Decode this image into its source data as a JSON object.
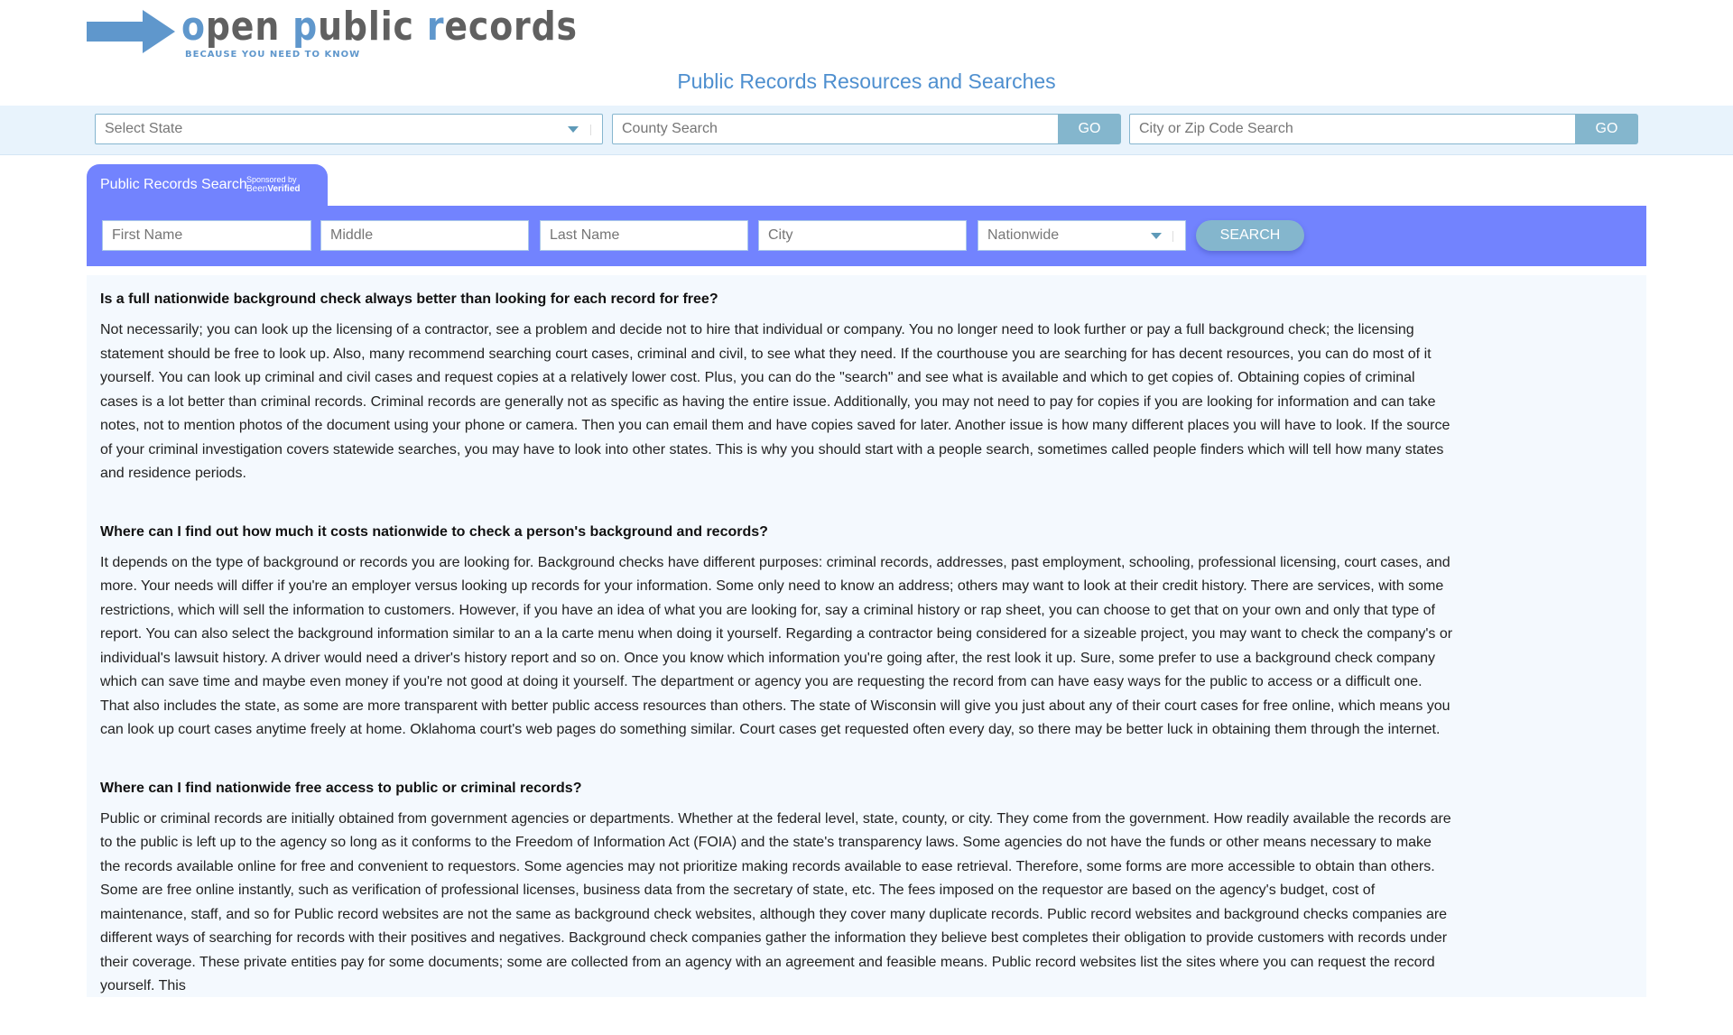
{
  "header": {
    "logo": {
      "parts": [
        {
          "text": "o",
          "highlight": true
        },
        {
          "text": "pen ",
          "highlight": false
        },
        {
          "text": "p",
          "highlight": true
        },
        {
          "text": "ublic ",
          "highlight": false
        },
        {
          "text": "r",
          "highlight": true
        },
        {
          "text": "ecords",
          "highlight": false
        }
      ],
      "tagline": "BECAUSE YOU NEED TO KNOW",
      "icon": "arrow-right-icon",
      "colors": {
        "accent": "#5f97cc",
        "text": "#606060"
      }
    },
    "page_title": "Public Records Resources and Searches"
  },
  "location_bar": {
    "state_select": {
      "value": "Select State"
    },
    "county_search": {
      "placeholder": "County Search",
      "button": "GO"
    },
    "city_zip_search": {
      "placeholder": "City or Zip Code Search",
      "button": "GO"
    }
  },
  "people_search": {
    "tab_label": "Public Records Search",
    "sponsor_prefix": "Sponsored by",
    "sponsor_brand_light": "Been",
    "sponsor_brand_bold": "Verified",
    "fields": {
      "first_name": "First Name",
      "middle": "Middle",
      "last_name": "Last Name",
      "city": "City"
    },
    "state_select": {
      "value": "Nationwide"
    },
    "search_button": "SEARCH",
    "colors": {
      "band": "#7283fe",
      "button": "#84b6cd"
    }
  },
  "faq": [
    {
      "question": "Is a full nationwide background check always better than looking for each record for free?",
      "answer": "Not necessarily; you can look up the licensing of a contractor, see a problem and decide not to hire that individual or company. You no longer need to look further or pay a full background check; the licensing statement should be free to look up. Also, many recommend searching court cases, criminal and civil, to see what they need. If the courthouse you are searching for has decent resources, you can do most of it yourself. You can look up criminal and civil cases and request copies at a relatively lower cost. Plus, you can do the \"search\" and see what is available and which to get copies of. Obtaining copies of criminal cases is a lot better than criminal records. Criminal records are generally not as specific as having the entire issue. Additionally, you may not need to pay for copies if you are looking for information and can take notes, not to mention photos of the document using your phone or camera. Then you can email them and have copies saved for later. Another issue is how many different places you will have to look. If the source of your criminal investigation covers statewide searches, you may have to look into other states. This is why you should start with a people search, sometimes called people finders which will tell how many states and residence periods."
    },
    {
      "question": "Where can I find out how much it costs nationwide to check a person's background and records?",
      "answer": "It depends on the type of background or records you are looking for. Background checks have different purposes: criminal records, addresses, past employment, schooling, professional licensing, court cases, and more. Your needs will differ if you're an employer versus looking up records for your information. Some only need to know an address; others may want to look at their credit history. There are services, with some restrictions, which will sell the information to customers. However, if you have an idea of what you are looking for, say a criminal history or rap sheet, you can choose to get that on your own and only that type of report. You can also select the background information similar to an a la carte menu when doing it yourself. Regarding a contractor being considered for a sizeable project, you may want to check the company's or individual's lawsuit history. A driver would need a driver's history report and so on. Once you know which information you're going after, the rest look it up. Sure, some prefer to use a background check company which can save time and maybe even money if you're not good at doing it yourself. The department or agency you are requesting the record from can have easy ways for the public to access or a difficult one. That also includes the state, as some are more transparent with better public access resources than others. The state of Wisconsin will give you just about any of their court cases for free online, which means you can look up court cases anytime freely at home. Oklahoma court's web pages do something similar. Court cases get requested often every day, so there may be better luck in obtaining them through the internet."
    },
    {
      "question": "Where can I find nationwide free access to public or criminal records?",
      "answer": "Public or criminal records are initially obtained from government agencies or departments. Whether at the federal level, state, county, or city. They come from the government. How readily available the records are to the public is left up to the agency so long as it conforms to the Freedom of Information Act (FOIA) and the state's transparency laws. Some agencies do not have the funds or other means necessary to make the records available online for free and convenient to requestors. Some agencies may not prioritize making records available to ease retrieval. Therefore, some forms are more accessible to obtain than others. Some are free online instantly, such as verification of professional licenses, business data from the secretary of state, etc. The fees imposed on the requestor are based on the agency's budget, cost of maintenance, staff, and so for Public record websites are not the same as background check websites, although they cover many duplicate records. Public record websites and background checks companies are different ways of searching for records with their positives and negatives. Background check companies gather the information they believe best completes their obligation to provide customers with records under their coverage. These private entities pay for some documents; some are collected from an agency with an agreement and feasible means. Public record websites list the sites where you can request the record yourself. This"
    }
  ]
}
